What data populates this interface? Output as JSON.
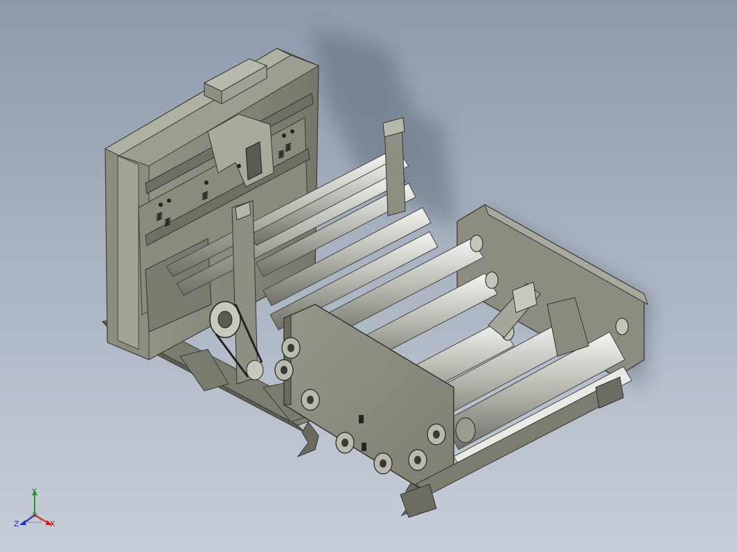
{
  "viewport": {
    "background_top": "#8d9aac",
    "background_bottom": "#c7ced8",
    "model_color": "#8a8a7c"
  },
  "triad": {
    "x_label": "X",
    "y_label": "Y",
    "z_label": "Z",
    "x_color": "#d02020",
    "y_color": "#20a020",
    "z_color": "#2030c0"
  }
}
